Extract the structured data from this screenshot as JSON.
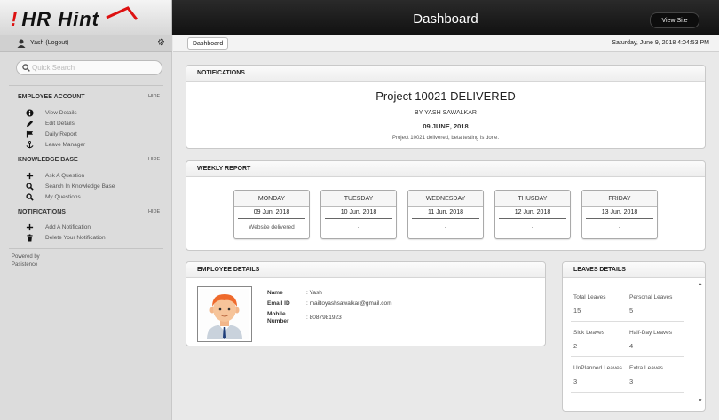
{
  "app": {
    "logo_text": "HR Hint",
    "logo_excl": "!"
  },
  "topbar": {
    "title": "Dashboard",
    "view_site_label": "View Site"
  },
  "user": {
    "name": "Yash (Logout)",
    "icon": "user-icon",
    "settings_icon": "gear-icon"
  },
  "search": {
    "placeholder": "Quick Search"
  },
  "sidebar": {
    "sections": [
      {
        "title": "EMPLOYEE ACCOUNT",
        "hide_label": "HIDE",
        "items": [
          {
            "label": "View Details",
            "icon": "info-icon"
          },
          {
            "label": "Edit Details",
            "icon": "pencil-icon"
          },
          {
            "label": "Daily Report",
            "icon": "flag-icon"
          },
          {
            "label": "Leave Manager",
            "icon": "anchor-icon"
          }
        ]
      },
      {
        "title": "KNOWLEDGE BASE",
        "hide_label": "HIDE",
        "items": [
          {
            "label": "Ask A Question",
            "icon": "plus-icon"
          },
          {
            "label": "Search In Knowledge Base",
            "icon": "search-icon"
          },
          {
            "label": "My Questions",
            "icon": "search-icon"
          }
        ]
      },
      {
        "title": "NOTIFICATIONS",
        "hide_label": "HIDE",
        "items": [
          {
            "label": "Add A Notification",
            "icon": "plus-icon"
          },
          {
            "label": "Delete Your Notification",
            "icon": "trash-icon"
          }
        ]
      }
    ],
    "powered_by_line1": "Powered by",
    "powered_by_line2": "Pasistence"
  },
  "breadcrumb": {
    "current": "Dashboard"
  },
  "datetime": "Saturday, June 9, 2018 4:04:53 PM",
  "notifications": {
    "heading": "NOTIFICATIONS",
    "title": "Project 10021 DELIVERED",
    "by": "BY YASH SAWALKAR",
    "date": "09 JUNE, 2018",
    "body": "Project 10021 delivered, beta testing is done."
  },
  "weekly_report": {
    "heading": "WEEKLY REPORT",
    "days": [
      {
        "day": "MONDAY",
        "date": "09 Jun, 2018",
        "note": "Website delivered"
      },
      {
        "day": "TUESDAY",
        "date": "10 Jun, 2018",
        "note": "-"
      },
      {
        "day": "WEDNESDAY",
        "date": "11 Jun, 2018",
        "note": "-"
      },
      {
        "day": "THUSDAY",
        "date": "12 Jun, 2018",
        "note": "-"
      },
      {
        "day": "FRIDAY",
        "date": "13 Jun, 2018",
        "note": "-"
      }
    ]
  },
  "employee": {
    "heading": "EMPLOYEE DETAILS",
    "name_label": "Name",
    "name_value": ": Yash",
    "email_label": "Email ID",
    "email_value": ": mailtoyashsawalkar@gmail.com",
    "mobile_label_1": "Mobile",
    "mobile_label_2": "Number",
    "mobile_value": ": 8087981923"
  },
  "leaves": {
    "heading": "LEAVES DETAILS",
    "items": [
      {
        "label": "Total Leaves",
        "value": "15"
      },
      {
        "label": "Personal Leaves",
        "value": "5"
      },
      {
        "label": "Sick Leaves",
        "value": "2"
      },
      {
        "label": "Half-Day Leaves",
        "value": "4"
      },
      {
        "label": "UnPlanned Leaves",
        "value": "3"
      },
      {
        "label": "Extra Leaves",
        "value": "3"
      }
    ]
  }
}
